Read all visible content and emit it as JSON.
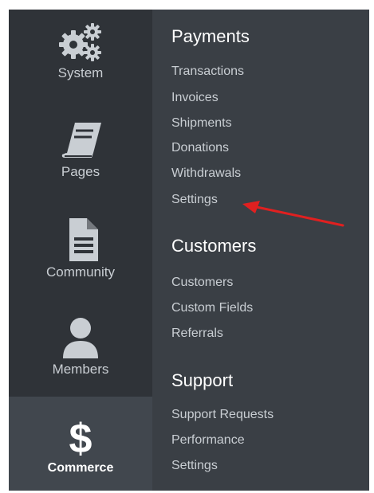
{
  "sidebar": {
    "items": [
      {
        "label": "System",
        "icon": "gears-icon"
      },
      {
        "label": "Pages",
        "icon": "book-icon"
      },
      {
        "label": "Community",
        "icon": "document-icon"
      },
      {
        "label": "Members",
        "icon": "user-icon"
      },
      {
        "label": "Commerce",
        "icon": "dollar-icon",
        "active": true
      }
    ]
  },
  "menu": {
    "sections": [
      {
        "title": "Payments",
        "links": [
          "Transactions",
          "Invoices",
          "Shipments",
          "Donations",
          "Withdrawals",
          "Settings"
        ]
      },
      {
        "title": "Customers",
        "links": [
          "Customers",
          "Custom Fields",
          "Referrals"
        ]
      },
      {
        "title": "Support",
        "links": [
          "Support Requests",
          "Performance",
          "Settings"
        ]
      }
    ]
  },
  "colors": {
    "sidebar_bg": "#2f3338",
    "panel_bg": "#3a3f45",
    "active_bg": "#41474e",
    "annotation_arrow": "#e02020"
  }
}
